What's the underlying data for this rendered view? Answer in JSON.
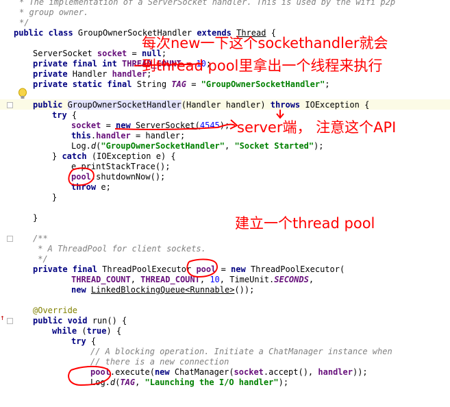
{
  "code_lines": {
    "l1": "* The implementation of a ServerSocket handler. This is used by the wifi p2p",
    "l2": "* group owner.",
    "l3": "*/",
    "l4a": "public class ",
    "l4b": "GroupOwnerSocketHandler ",
    "l4c": "extends ",
    "l4d": "Thread",
    "l4e": " {",
    "l5a": "ServerSocket ",
    "l5b": "socket",
    "l5c": " = ",
    "l5d": "null",
    "l5e": ";",
    "l6a": "private final int ",
    "l6b": "THREAD_COUNT",
    "l6c": " = ",
    "l6d": "10",
    "l6e": ";",
    "l7a": "private ",
    "l7b": "Handler ",
    "l7c": "handler",
    "l7d": ";",
    "l8a": "private static final ",
    "l8b": "String ",
    "l8c": "TAG",
    "l8d": " = ",
    "l8e": "\"GroupOwnerSocketHandler\"",
    "l8f": ";",
    "l9a": "public ",
    "l9b": "GroupOwnerSocketHandler",
    "l9c": "(Handler handler) ",
    "l9d": "throws ",
    "l9e": "IOException {",
    "l10a": "try ",
    "l10b": "{",
    "l11a": "socket",
    "l11b": " = ",
    "l11c": "new ",
    "l11d": "ServerSocket(",
    "l11e": "4545",
    "l11f": ");",
    "l12a": "this",
    "l12b": ".",
    "l12c": "handler",
    "l12d": " = handler;",
    "l13a": "Log.",
    "l13b": "d",
    "l13c": "(",
    "l13d": "\"GroupOwnerSocketHandler\"",
    "l13e": ", ",
    "l13f": "\"Socket Started\"",
    "l13g": ");",
    "l14a": "} ",
    "l14b": "catch ",
    "l14c": "(IOException e) {",
    "l15": "e.printStackTrace();",
    "l16a": "pool",
    "l16b": ".shutdownNow();",
    "l17a": "throw ",
    "l17b": "e;",
    "l18": "}",
    "l19": "}",
    "l20": "/**",
    "l21": " * A ThreadPool for client sockets.",
    "l22": " */",
    "l23a": "private final ",
    "l23b": "ThreadPoolExecutor ",
    "l23c": "pool",
    "l23d": " = ",
    "l23e": "new ",
    "l23f": "ThreadPoolExecutor(",
    "l24a": "THREAD_COUNT",
    "l24b": ", ",
    "l24c": "THREAD_COUNT",
    "l24d": ", ",
    "l24e": "10",
    "l24f": ", TimeUnit.",
    "l24g": "SECONDS",
    "l24h": ",",
    "l25a": "new ",
    "l25b": "LinkedBlockingQueue<Runnable>",
    "l25c": "());",
    "l26": "@Override",
    "l27a": "public void ",
    "l27b": "run() {",
    "l28a": "while ",
    "l28b": "(",
    "l28c": "true",
    "l28d": ") {",
    "l29a": "try ",
    "l29b": "{",
    "l30": "// A blocking operation. Initiate a ChatManager instance when",
    "l31": "// there is a new connection",
    "l32a": "pool",
    "l32b": ".execute(",
    "l32c": "new ",
    "l32d": "ChatManager(",
    "l32e": "socket",
    "l32f": ".accept(), ",
    "l32g": "handler",
    "l32h": "));",
    "l33a": "Log.",
    "l33b": "d",
    "l33c": "(",
    "l33d": "TAG",
    "l33e": ", ",
    "l33f": "\"Launching the I/O handler\"",
    "l33g": ");"
  },
  "annotations": {
    "note1_line1": "每次new一下这个sockethandler就会",
    "note1_line2": "到thread pool里拿出一个线程来执行",
    "note2": "server端， 注意这个API",
    "note3": "建立一个thread pool"
  },
  "colors": {
    "annotation": "#ff0000",
    "keyword": "#000080",
    "field": "#660e7a",
    "string": "#008000",
    "number": "#0000ff",
    "comment": "#808080"
  }
}
